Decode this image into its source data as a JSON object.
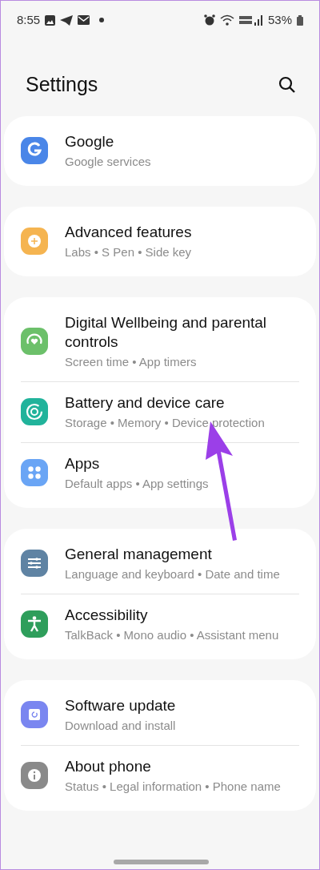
{
  "status_bar": {
    "time": "8:55",
    "battery": "53%"
  },
  "header": {
    "title": "Settings"
  },
  "groups": [
    {
      "items": [
        {
          "kind": "google",
          "title": "Google",
          "subtitle": "Google services",
          "color": "#4a86e8"
        }
      ]
    },
    {
      "items": [
        {
          "kind": "advanced",
          "title": "Advanced features",
          "subtitle": "Labs • S Pen • Side key",
          "color": "#f5b450"
        }
      ]
    },
    {
      "items": [
        {
          "kind": "wellbeing",
          "title": "Digital Wellbeing and parental controls",
          "subtitle": "Screen time • App timers",
          "color": "#6cc06a"
        },
        {
          "kind": "battery",
          "title": "Battery and device care",
          "subtitle": "Storage • Memory • Device protection",
          "color": "#21b39b"
        },
        {
          "kind": "apps",
          "title": "Apps",
          "subtitle": "Default apps • App settings",
          "color": "#6aa5f5"
        }
      ]
    },
    {
      "items": [
        {
          "kind": "general",
          "title": "General management",
          "subtitle": "Language and keyboard • Date and time",
          "color": "#5f83a3"
        },
        {
          "kind": "accessibility",
          "title": "Accessibility",
          "subtitle": "TalkBack • Mono audio • Assistant menu",
          "color": "#2e9e5b"
        }
      ]
    },
    {
      "items": [
        {
          "kind": "update",
          "title": "Software update",
          "subtitle": "Download and install",
          "color": "#7a86f0"
        },
        {
          "kind": "about",
          "title": "About phone",
          "subtitle": "Status • Legal information • Phone name",
          "color": "#8a8a8a"
        }
      ]
    }
  ]
}
